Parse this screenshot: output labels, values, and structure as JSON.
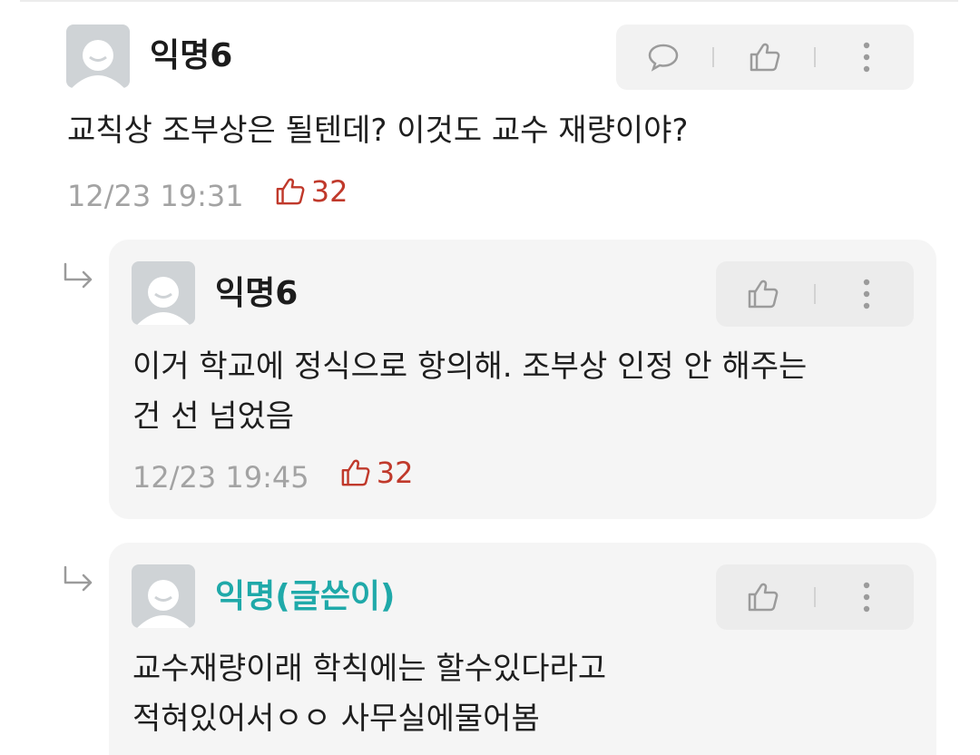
{
  "comments": [
    {
      "author": "익명6",
      "body_lines": [
        "교칙상 조부상은 될텐데? 이것도 교수 재량이야?"
      ],
      "time": "12/23 19:31",
      "likes": "32"
    }
  ],
  "replies": [
    {
      "author": "익명6",
      "body_lines": [
        "이거 학교에 정식으로 항의해. 조부상 인정 안 해주는",
        "건 선 넘었음"
      ],
      "time": "12/23 19:45",
      "likes": "32"
    },
    {
      "author": "익명(글쓴이)",
      "body_lines": [
        "교수재량이래 학칙에는 할수있다라고",
        "적혀있어서ㅇㅇ 사무실에물어봄"
      ]
    }
  ],
  "colors": {
    "writer_accent": "#1fa9a9",
    "like_red": "#c0392b",
    "timestamp_gray": "#a3a3a3"
  },
  "icons": [
    "avatar-icon",
    "speech-bubble-icon",
    "thumbs-up-icon",
    "more-vertical-icon",
    "reply-arrow-icon"
  ]
}
